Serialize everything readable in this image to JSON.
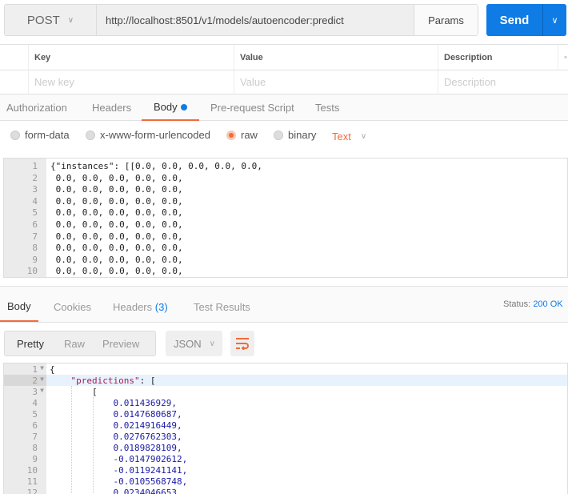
{
  "request": {
    "method": "POST",
    "url": "http://localhost:8501/v1/models/autoencoder:predict",
    "params_label": "Params",
    "send_label": "Send"
  },
  "params_table": {
    "headers": [
      "Key",
      "Value",
      "Description"
    ],
    "placeholders": [
      "New key",
      "Value",
      "Description"
    ]
  },
  "request_tabs": [
    "Authorization",
    "Headers",
    "Body",
    "Pre-request Script",
    "Tests"
  ],
  "body_modes": [
    "form-data",
    "x-www-form-urlencoded",
    "raw",
    "binary"
  ],
  "body_type": "Text",
  "request_body": [
    "{\"instances\": [[0.0, 0.0, 0.0, 0.0, 0.0,",
    " 0.0, 0.0, 0.0, 0.0, 0.0,",
    " 0.0, 0.0, 0.0, 0.0, 0.0,",
    " 0.0, 0.0, 0.0, 0.0, 0.0,",
    " 0.0, 0.0, 0.0, 0.0, 0.0,",
    " 0.0, 0.0, 0.0, 0.0, 0.0,",
    " 0.0, 0.0, 0.0, 0.0, 0.0,",
    " 0.0, 0.0, 0.0, 0.0, 0.0,",
    " 0.0, 0.0, 0.0, 0.0, 0.0,",
    " 0.0, 0.0, 0.0, 0.0, 0.0,",
    " 0.0, 0.0, 0.0, 0.0, 0.0,"
  ],
  "response": {
    "tabs": [
      "Body",
      "Cookies",
      "Headers",
      "Test Results"
    ],
    "headers_count": "(3)",
    "status_label": "Status:",
    "status_value": "200 OK",
    "view_modes": [
      "Pretty",
      "Raw",
      "Preview"
    ],
    "format": "JSON",
    "lines": [
      "{",
      "    \"predictions\": [",
      "        [",
      "            0.011436929,",
      "            0.0147680687,",
      "            0.0214916449,",
      "            0.0276762303,",
      "            0.0189828109,",
      "            -0.0147902612,",
      "            -0.0119241141,",
      "            -0.0105568748,",
      "            0.0234046653,"
    ],
    "foldable_lines": [
      1,
      2,
      3
    ]
  },
  "colors": {
    "accent": "#f26b3a",
    "send": "#0f7ce6",
    "json_key": "#a11d5a",
    "json_number": "#1a1aa6"
  }
}
